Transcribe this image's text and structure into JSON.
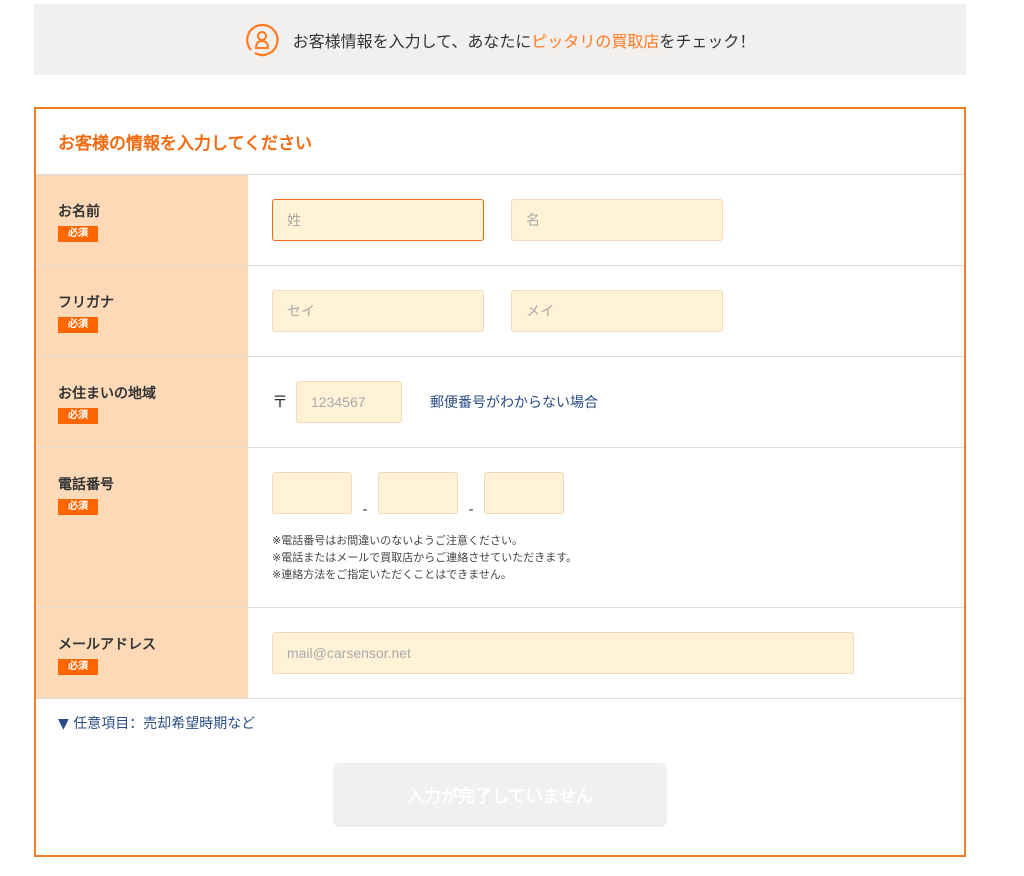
{
  "banner": {
    "text_before": "お客様情報を入力して、あなたに",
    "text_accent": "ピッタリの買取店",
    "text_after": "をチェック！",
    "icon": "person-icon",
    "accent_color": "#ff7a21"
  },
  "form": {
    "heading": "お客様の情報を入力してください",
    "required_badge": "必須",
    "name": {
      "label": "お名前",
      "last_placeholder": "姓",
      "first_placeholder": "名"
    },
    "kana": {
      "label": "フリガナ",
      "last_placeholder": "セイ",
      "first_placeholder": "メイ"
    },
    "address": {
      "label": "お住まいの地域",
      "postal_mark": "〒",
      "zip_placeholder": "1234567",
      "zip_unknown_link": "郵便番号がわからない場合"
    },
    "phone": {
      "label": "電話番号",
      "separator": "-",
      "notes": [
        "※電話番号はお間違いのないようご注意ください。",
        "※電話またはメールで買取店からご連絡させていただきます。",
        "※連絡方法をご指定いただくことはできません。"
      ]
    },
    "email": {
      "label": "メールアドレス",
      "placeholder": "mail@carsensor.net"
    },
    "optional_toggle": "▼ 任意項目：売却希望時期など",
    "submit_label": "入力が完了していません",
    "accent_color": "#f47a26",
    "label_bg_color": "#fdd9b8",
    "input_bg_color": "#fff2d6"
  }
}
